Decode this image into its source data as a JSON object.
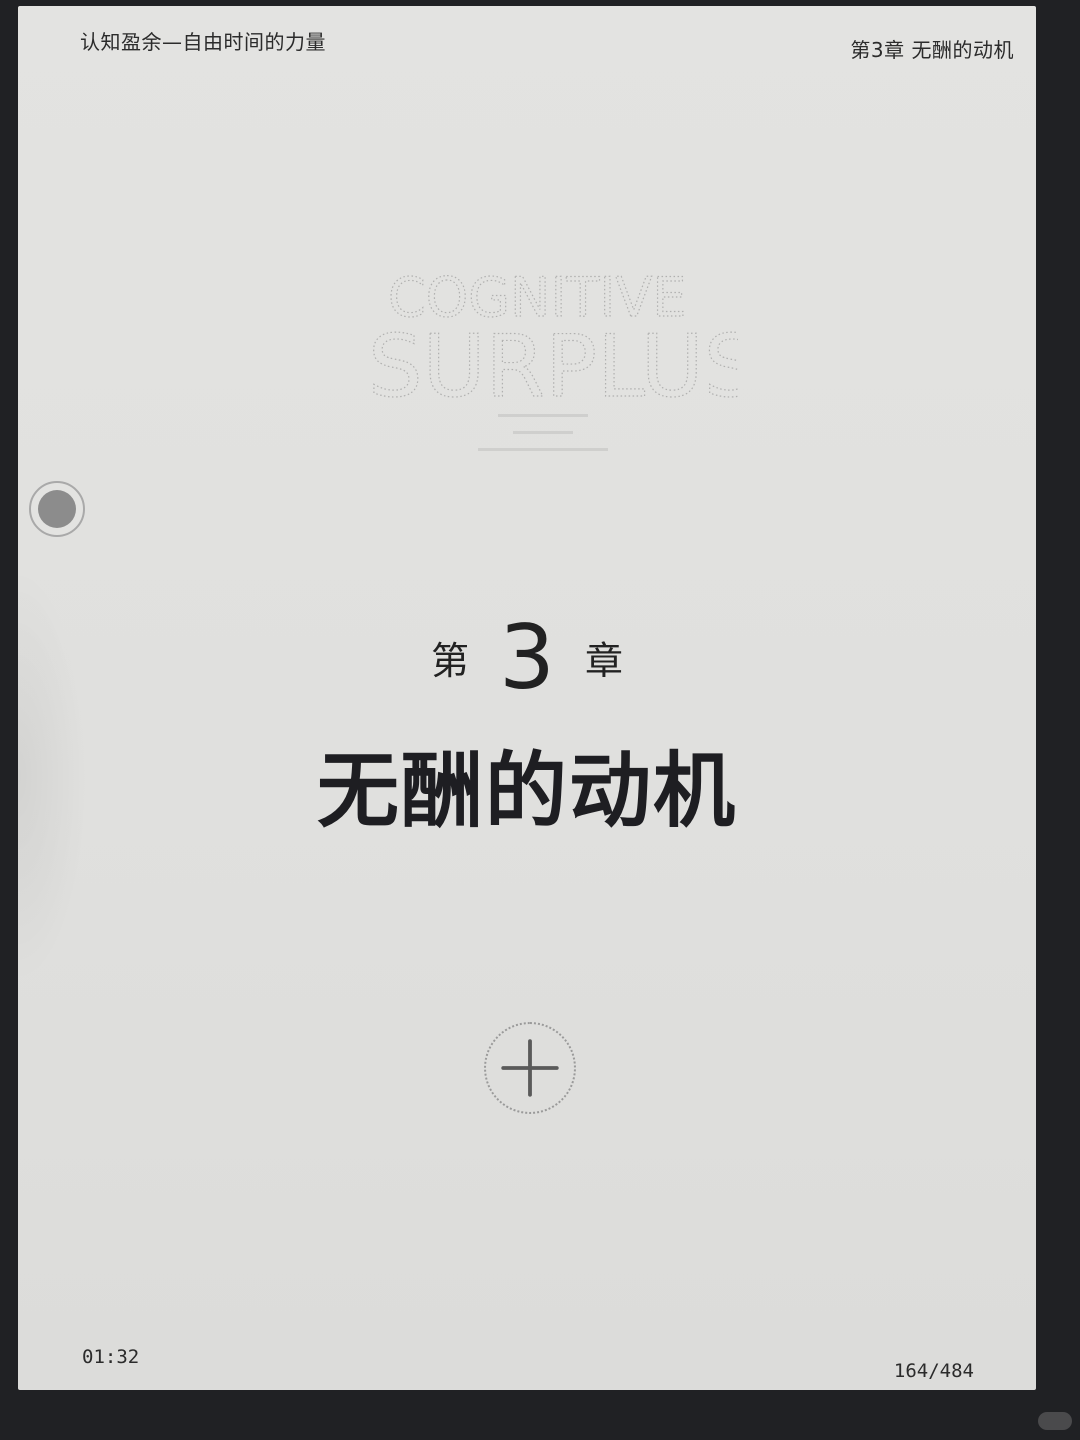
{
  "header": {
    "book_title": "认知盈余—自由时间的力量",
    "chapter_indicator": "第3章 无酬的动机"
  },
  "cover_art": {
    "line1": "COGNITIVE",
    "line2": "SURPLUS"
  },
  "chapter": {
    "prefix": "第",
    "number": "3",
    "suffix": "章",
    "title": "无酬的动机"
  },
  "footer": {
    "clock": "01:32",
    "page_counter": "164/484"
  },
  "icons": {
    "floating": "floating-circle-icon",
    "add": "plus-icon"
  }
}
